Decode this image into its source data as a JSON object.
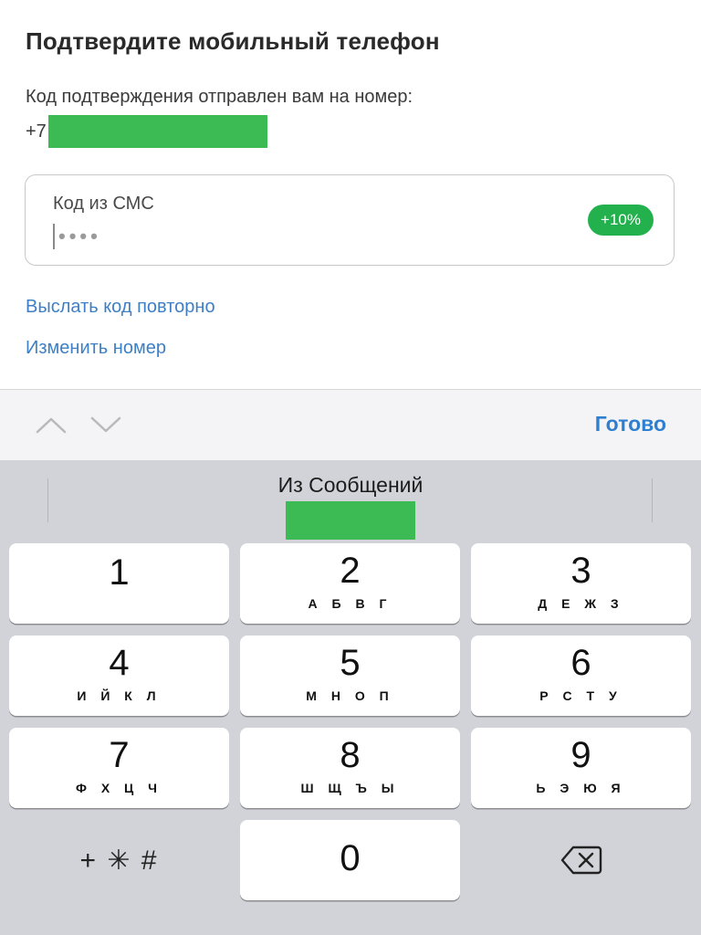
{
  "page": {
    "title": "Подтвердите мобильный телефон",
    "sent_text": "Код подтверждения отправлен вам на номер:",
    "phone_prefix": "+7",
    "redaction_color": "#3cba54"
  },
  "sms_field": {
    "label": "Код из СМС",
    "value_masked": "••••",
    "badge": "+10%",
    "badge_color": "#22b14c"
  },
  "links": {
    "resend": "Выслать код повторно",
    "change_number": "Изменить номер"
  },
  "accessory_bar": {
    "prev_icon": "chevron-up-icon",
    "next_icon": "chevron-down-icon",
    "done_label": "Готово"
  },
  "keyboard": {
    "suggestion_label": "Из Сообщений",
    "keys": [
      {
        "digit": "1",
        "letters": ""
      },
      {
        "digit": "2",
        "letters": "А Б В Г"
      },
      {
        "digit": "3",
        "letters": "Д Е Ж З"
      },
      {
        "digit": "4",
        "letters": "И Й К Л"
      },
      {
        "digit": "5",
        "letters": "М Н О П"
      },
      {
        "digit": "6",
        "letters": "Р С Т У"
      },
      {
        "digit": "7",
        "letters": "Ф Х Ц Ч"
      },
      {
        "digit": "8",
        "letters": "Ш Щ Ъ Ы"
      },
      {
        "digit": "9",
        "letters": "Ь Э Ю Я"
      }
    ],
    "symbols_label": "+ ✳ #",
    "zero": "0",
    "delete_icon": "backspace-icon"
  }
}
